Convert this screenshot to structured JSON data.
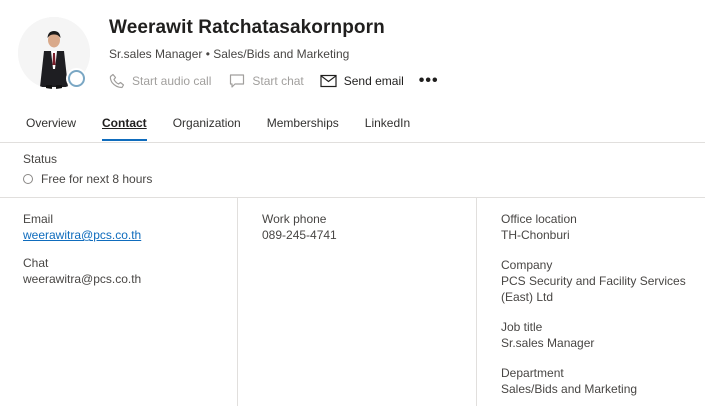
{
  "profile": {
    "name": "Weerawit Ratchatasakornporn",
    "subtitle": "Sr.sales Manager • Sales/Bids and Marketing",
    "presence_color": "#7aa7c4"
  },
  "actions": {
    "audio": {
      "label": "Start audio call",
      "icon": "phone-icon",
      "enabled": false
    },
    "chat": {
      "label": "Start chat",
      "icon": "chat-icon",
      "enabled": false
    },
    "email": {
      "label": "Send email",
      "icon": "mail-icon",
      "enabled": true
    },
    "more": {
      "label": "•••",
      "icon": "more-icon"
    }
  },
  "tabs": [
    {
      "label": "Overview",
      "active": false
    },
    {
      "label": "Contact",
      "active": true
    },
    {
      "label": "Organization",
      "active": false
    },
    {
      "label": "Memberships",
      "active": false
    },
    {
      "label": "LinkedIn",
      "active": false
    }
  ],
  "status": {
    "label": "Status",
    "value": "Free for next 8 hours"
  },
  "contact": {
    "email": {
      "label": "Email",
      "value": "weerawitra@pcs.co.th"
    },
    "chat": {
      "label": "Chat",
      "value": "weerawitra@pcs.co.th"
    },
    "work_phone": {
      "label": "Work phone",
      "value": "089-245-4741"
    },
    "office_location": {
      "label": "Office location",
      "value": "TH-Chonburi"
    },
    "company": {
      "label": "Company",
      "value": "PCS Security and Facility Services (East) Ltd"
    },
    "job_title": {
      "label": "Job title",
      "value": "Sr.sales Manager"
    },
    "department": {
      "label": "Department",
      "value": "Sales/Bids and Marketing"
    }
  },
  "colors": {
    "accent": "#0f6cbd",
    "divider": "#e1dfdd",
    "text": "#323130"
  }
}
